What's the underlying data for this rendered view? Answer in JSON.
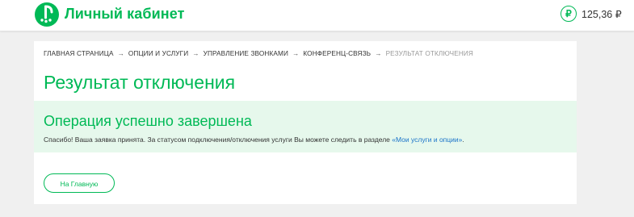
{
  "header": {
    "brand": "Личный кабинет",
    "logo_icon": "megafon-logo-icon",
    "balance_icon": "ruble-icon",
    "balance_symbol": "₽",
    "balance": "125,36 ₽"
  },
  "breadcrumb": {
    "items": [
      "ГЛАВНАЯ СТРАНИЦА",
      "ОПЦИИ И УСЛУГИ",
      "УПРАВЛЕНИЕ ЗВОНКАМИ",
      "КОНФЕРЕНЦ-СВЯЗЬ"
    ],
    "separator": "→",
    "current": "РЕЗУЛЬТАТ ОТКЛЮЧЕНИЯ"
  },
  "page": {
    "title": "Результат отключения"
  },
  "success": {
    "title": "Операция успешно завершена",
    "text": "Спасибо! Ваша заявка принята. За статусом подключения/отключения услуги Вы можете следить в разделе ",
    "link": "«Мои услуги и опции»",
    "text_end": "."
  },
  "actions": {
    "home_label": "На Главную"
  },
  "colors": {
    "brand_green": "#00b956",
    "success_bg": "#e6f8ec",
    "link_blue": "#1a73c9",
    "page_bg": "#f0f0f0"
  }
}
